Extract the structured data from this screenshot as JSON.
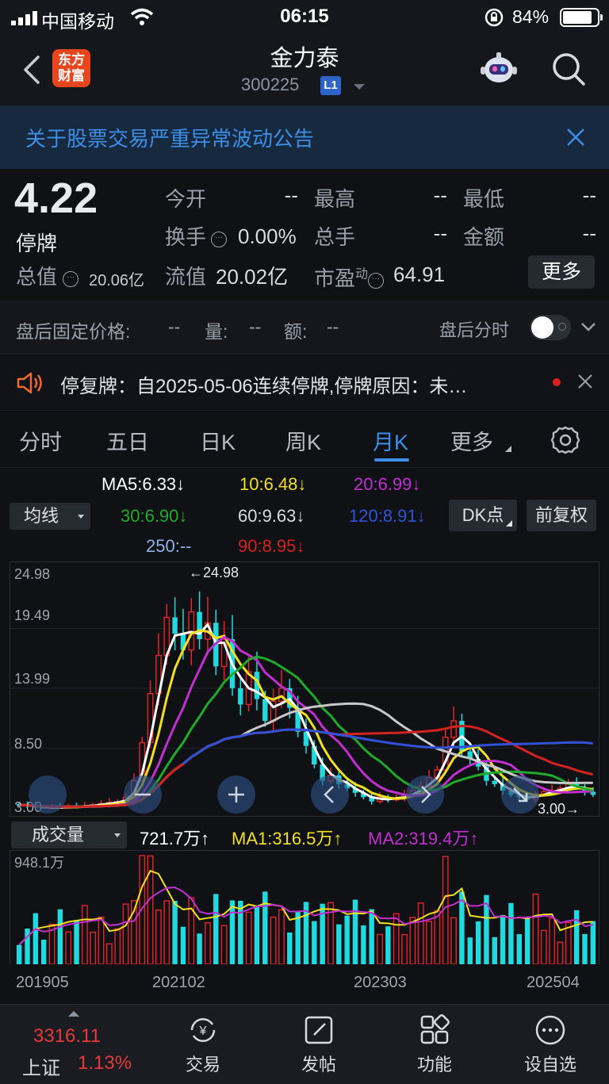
{
  "status": {
    "carrier": "中国移动",
    "time": "06:15",
    "battery_pct": "84%",
    "battery_level": 0.84
  },
  "header": {
    "logo_text": "东方财富",
    "title": "金力泰",
    "code": "300225",
    "level_badge": "L1"
  },
  "announcement": {
    "text": "关于股票交易严重异常波动公告"
  },
  "quote": {
    "price": "4.22",
    "status": "停牌",
    "total_value_label": "总值",
    "total_value": "20.06亿",
    "open_label": "今开",
    "open_value": "--",
    "high_label": "最高",
    "high_value": "--",
    "low_label": "最低",
    "low_value": "--",
    "turnover_label": "换手",
    "turnover_value": "0.00%",
    "total_hands_label": "总手",
    "total_hands_value": "--",
    "amount_label": "金额",
    "amount_value": "--",
    "float_label": "流值",
    "float_value": "20.02亿",
    "pe_label": "市盈",
    "pe_sup": "动",
    "pe_value": "64.91",
    "more_label": "更多"
  },
  "after_hours": {
    "fixed_price_label": "盘后固定价格:",
    "fixed_price_value": "--",
    "volume_label": "量:",
    "volume_value": "--",
    "amount_label": "额:",
    "amount_value": "--",
    "timeshare_label": "盘后分时"
  },
  "notice": {
    "text": "停复牌：自2025-05-06连续停牌,停牌原因：未…"
  },
  "tabs": [
    "分时",
    "五日",
    "日K",
    "周K",
    "月K",
    "更多"
  ],
  "active_tab": "月K",
  "ma_legend": {
    "ma5": "MA5:6.33↓",
    "ma10": "10:6.48↓",
    "ma20": "20:6.99↓",
    "ma30": "30:6.90↓",
    "ma60": "60:9.63↓",
    "ma120": "120:8.91↓",
    "ma250": "250:--",
    "ma90": "90:8.95↓",
    "indicator_select": "均线",
    "dk_button": "DK点",
    "adjust_button": "前复权",
    "colors": {
      "ma5": "#ffffff",
      "ma10": "#f1e01f",
      "ma20": "#c22fd0",
      "ma30": "#1faa2a",
      "ma60": "#c8c8c8",
      "ma120": "#3152d8",
      "ma250": "#8fb2e8",
      "ma90": "#d4221f"
    }
  },
  "chart_labels": {
    "y_ticks": [
      "24.98",
      "19.49",
      "13.99",
      "8.50",
      "3.00"
    ],
    "high_marker": "←24.98",
    "low_marker": "3.00→"
  },
  "volume": {
    "select": "成交量",
    "value": "721.7万↑",
    "ma1": "MA1:316.5万↑",
    "ma2": "MA2:319.4万↑",
    "max_label": "948.1万"
  },
  "x_axis": [
    "201905",
    "202102",
    "202303",
    "202504"
  ],
  "bottom": {
    "index_value": "3316.11",
    "index_name": "上证",
    "index_pct": "1.13%",
    "nav": [
      "交易",
      "发帖",
      "功能",
      "设自选"
    ]
  },
  "chart_data": {
    "type": "candlestick",
    "title": "",
    "period": "monthly",
    "ylim": [
      3.0,
      24.98
    ],
    "x_range": [
      "201905",
      "202504"
    ],
    "price_high": 24.98,
    "price_low": 3.0,
    "monthly_close_approx": [
      3.3,
      3.2,
      3.1,
      3.0,
      3.1,
      3.0,
      3.2,
      3.1,
      3.2,
      3.3,
      3.4,
      3.5,
      3.6,
      4.0,
      5.5,
      9.0,
      13.5,
      17.0,
      20.5,
      19.0,
      17.5,
      21.0,
      18.5,
      20.0,
      16.0,
      18.5,
      14.0,
      12.5,
      15.5,
      13.0,
      11.0,
      12.8,
      14.0,
      12.2,
      10.0,
      8.7,
      7.0,
      5.5,
      6.0,
      5.2,
      4.8,
      4.4,
      4.0,
      3.6,
      4.0,
      3.8,
      3.9,
      4.2,
      4.6,
      5.0,
      5.8,
      6.5,
      9.5,
      11.0,
      8.2,
      7.5,
      6.8,
      5.5,
      5.2,
      4.6,
      4.2,
      4.0,
      3.8,
      4.3,
      4.5,
      4.6,
      4.8,
      5.2,
      4.9,
      4.5,
      4.22
    ],
    "ma_lines": [
      {
        "name": "MA5",
        "color": "#ffffff"
      },
      {
        "name": "MA10",
        "color": "#f1e01f"
      },
      {
        "name": "MA20",
        "color": "#c22fd0"
      },
      {
        "name": "MA30",
        "color": "#1faa2a"
      },
      {
        "name": "MA60",
        "color": "#c8c8c8"
      },
      {
        "name": "MA90",
        "color": "#d4221f"
      },
      {
        "name": "MA120",
        "color": "#3152d8"
      }
    ],
    "volume_max": "948.1万"
  }
}
